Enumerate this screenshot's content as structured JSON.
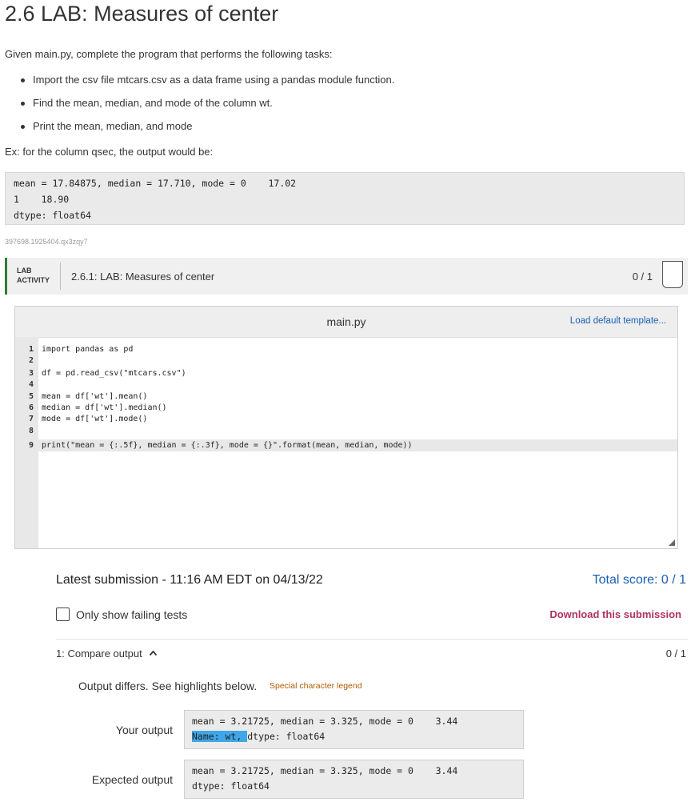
{
  "title": "2.6 LAB: Measures of center",
  "intro": "Given main.py, complete the program that performs the following tasks:",
  "tasks": [
    "Import the csv file mtcars.csv as a data frame using a pandas module function.",
    "Find the mean, median, and mode of the column wt.",
    "Print the mean, median, and mode"
  ],
  "example_label": "Ex: for the column qsec, the output would be:",
  "example_output": [
    "mean = 17.84875, median = 17.710, mode = 0    17.02",
    "1    18.90",
    "dtype: float64"
  ],
  "code_id": "397698.1925404.qx3zqy7",
  "lab": {
    "tag_line1": "LAB",
    "tag_line2": "ACTIVITY",
    "name": "2.6.1: LAB: Measures of center",
    "score": "0 / 1"
  },
  "editor": {
    "file_name": "main.py",
    "load_template": "Load default template...",
    "lines": [
      {
        "num": "1",
        "text": "import pandas as pd"
      },
      {
        "num": "2",
        "text": ""
      },
      {
        "num": "3",
        "text": "df = pd.read_csv(\"mtcars.csv\")"
      },
      {
        "num": "4",
        "text": ""
      },
      {
        "num": "5",
        "text": "mean = df['wt'].mean()"
      },
      {
        "num": "6",
        "text": "median = df['wt'].median()"
      },
      {
        "num": "7",
        "text": "mode = df['wt'].mode()"
      },
      {
        "num": "8",
        "text": ""
      },
      {
        "num": "9",
        "text": "print(\"mean = {:.5f}, median = {:.3f}, mode = {}\".format(mean, median, mode))"
      }
    ]
  },
  "submission": {
    "latest": "Latest submission - 11:16 AM EDT on 04/13/22",
    "total_score": "Total score: 0 / 1",
    "only_failing": "Only show failing tests",
    "download": "Download this submission",
    "test_name": "1: Compare output",
    "test_score": "0 / 1",
    "differs": "Output differs. See highlights below.",
    "legend": "Special character legend",
    "your_output_label": "Your output",
    "your_output_line1": "mean = 3.21725, median = 3.325, mode = 0    3.44",
    "your_output_line2_hl": "Name: wt, ",
    "your_output_line2_rest": "dtype: float64",
    "expected_output_label": "Expected output",
    "expected_output_line1": "mean = 3.21725, median = 3.325, mode = 0    3.44",
    "expected_output_line2": "dtype: float64"
  }
}
